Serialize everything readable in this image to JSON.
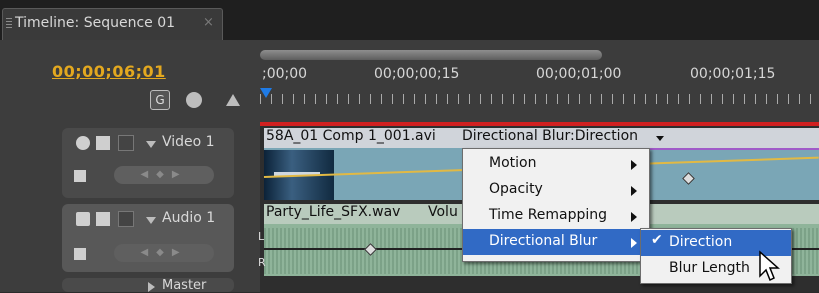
{
  "window": {
    "tab_title": "Timeline: Sequence 01",
    "tab_close": "×"
  },
  "header": {
    "timecode": "00;00;06;01",
    "snap_icon": "G"
  },
  "ruler": {
    "labels": [
      ";00;00",
      "00;00;00;15",
      "00;00;01;00",
      "00;00;01;15"
    ]
  },
  "tracks": {
    "video": {
      "name": "Video 1"
    },
    "audio": {
      "name": "Audio 1",
      "channels": [
        "L",
        "R"
      ]
    },
    "master": {
      "name": "Master"
    }
  },
  "clips": {
    "video_clip_name": "58A_01 Comp 1_001.avi",
    "video_effect": "Directional Blur:Direction",
    "audio_clip_name": "Party_Life_SFX.wav",
    "audio_effect": "Volu"
  },
  "context_menu": {
    "items": [
      {
        "label": "Motion",
        "submenu": true
      },
      {
        "label": "Opacity",
        "submenu": true
      },
      {
        "label": "Time Remapping",
        "submenu": true
      },
      {
        "label": "Directional Blur",
        "submenu": true,
        "active": true
      }
    ]
  },
  "submenu": {
    "items": [
      {
        "label": "Direction",
        "checked": true,
        "active": true
      },
      {
        "label": "Blur Length",
        "checked": false
      }
    ],
    "check_glyph": "✔"
  },
  "colors": {
    "timecode": "#e3a81f",
    "highlight": "#316ac5",
    "playhead": "#1f7be6",
    "work_area_red": "#d02020"
  }
}
